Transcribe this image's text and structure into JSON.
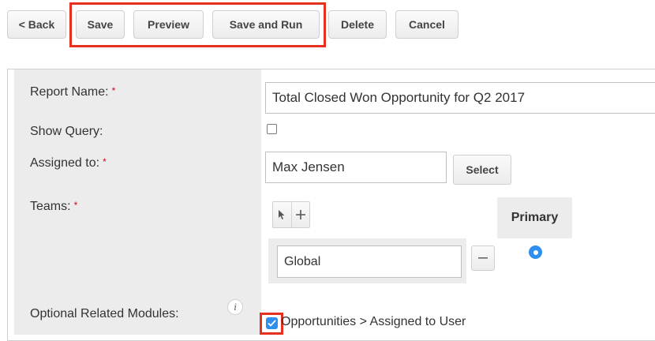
{
  "toolbar": {
    "back": "< Back",
    "save": "Save",
    "preview": "Preview",
    "save_and_run": "Save and Run",
    "delete": "Delete",
    "cancel": "Cancel"
  },
  "form": {
    "report_name_label": "Report Name:",
    "report_name_value": "Total Closed Won Opportunity for Q2 2017",
    "show_query_label": "Show Query:",
    "show_query_checked": false,
    "assigned_to_label": "Assigned to:",
    "assigned_to_value": "Max Jensen",
    "select_button": "Select",
    "teams_label": "Teams:",
    "primary_header": "Primary",
    "team_value": "Global",
    "team_primary_selected": true,
    "optional_related_label": "Optional Related Modules:",
    "related_module_option": "Opportunities > Assigned to User",
    "related_module_checked": true,
    "required_marker": "*"
  },
  "colors": {
    "highlight": "#e8301e",
    "required": "#d0021b",
    "accent": "#2e8ff0"
  }
}
